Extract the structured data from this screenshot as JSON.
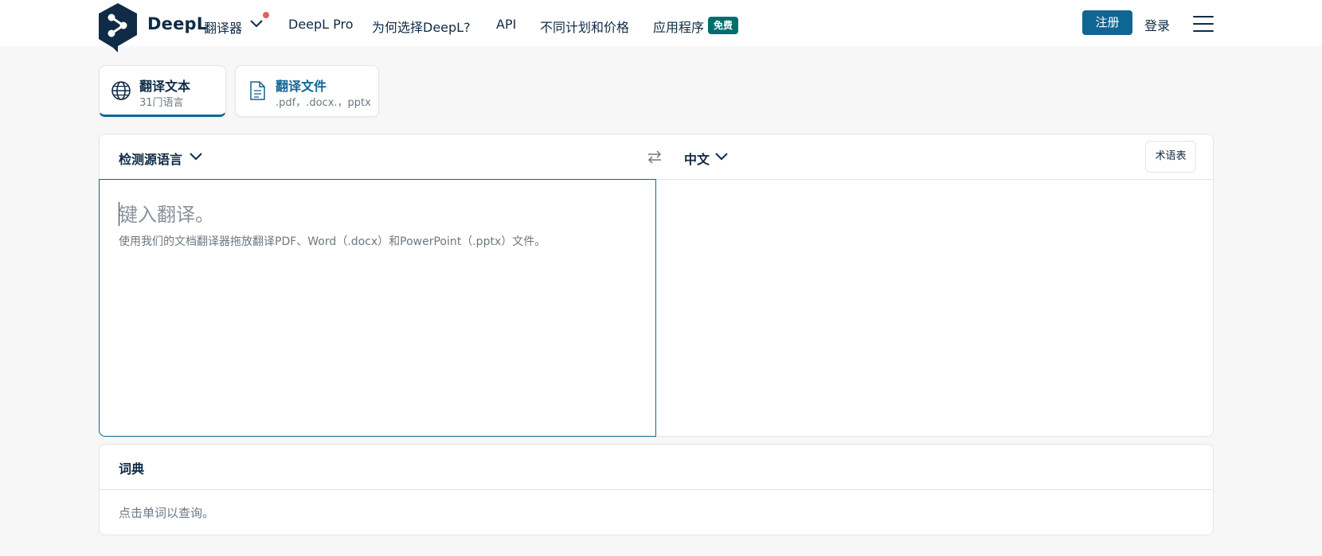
{
  "header": {
    "brand": "DeepL",
    "brand_sub": "翻译器",
    "nav": [
      {
        "label": "DeepL Pro"
      },
      {
        "label": "为何选择DeepL?"
      },
      {
        "label": "API"
      },
      {
        "label": "不同计划和价格"
      },
      {
        "label": "应用程序"
      }
    ],
    "free_badge": "免费",
    "signup": "注册",
    "login": "登录"
  },
  "tabs": [
    {
      "title": "翻译文本",
      "sub": "31门语言",
      "active": true
    },
    {
      "title": "翻译文件",
      "sub": ".pdf，.docx.，pptx",
      "active": false
    }
  ],
  "translator": {
    "source_lang": "检测源语言",
    "target_lang": "中文",
    "glossary": "术语表",
    "placeholder": "键入翻译。",
    "hint": "使用我们的文档翻译器拖放翻译PDF、Word（.docx）和PowerPoint（.pptx）文件。"
  },
  "dictionary": {
    "title": "词典",
    "hint": "点击单词以查询。"
  },
  "colors": {
    "brand_dark": "#0f2b46",
    "accent_blue": "#0f6695",
    "badge_green": "#006f6c",
    "notification": "#e06161"
  }
}
